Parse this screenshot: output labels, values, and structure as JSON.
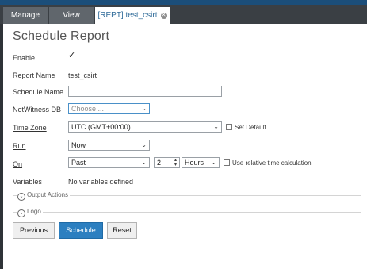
{
  "tabs": [
    {
      "label": "Manage"
    },
    {
      "label": "View"
    },
    {
      "label": "[REPT] test_csirt"
    }
  ],
  "form": {
    "title": "Schedule Report",
    "enable": {
      "label": "Enable",
      "checked": true,
      "mark": "✓"
    },
    "report_name": {
      "label": "Report Name",
      "value": "test_csirt"
    },
    "schedule_name": {
      "label": "Schedule Name",
      "value": ""
    },
    "netwitness_db": {
      "label": "NetWitness DB",
      "placeholder": "Choose ..."
    },
    "time_zone": {
      "label": "Time Zone",
      "value": "UTC (GMT+00:00)",
      "set_default_label": "Set Default"
    },
    "run": {
      "label": "Run",
      "value": "Now"
    },
    "on": {
      "label": "On",
      "range": "Past",
      "count": "2",
      "unit": "Hours",
      "relative_label": "Use relative time calculation"
    },
    "variables": {
      "label": "Variables",
      "value": "No variables defined"
    }
  },
  "sections": {
    "output_actions": "Output Actions",
    "logo": "Logo"
  },
  "buttons": {
    "previous": "Previous",
    "schedule": "Schedule",
    "reset": "Reset"
  },
  "colors": {
    "accent": "#2c7fc0",
    "tab_active_text": "#2f6b99",
    "top_strip": "#1b4e7a"
  }
}
